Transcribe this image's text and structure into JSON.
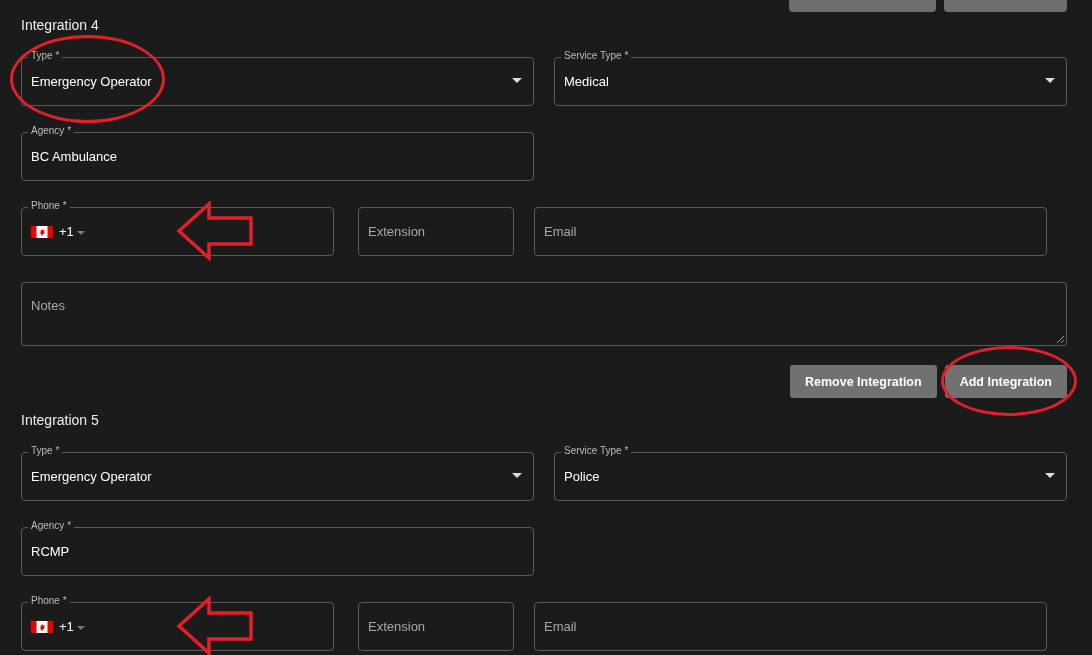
{
  "integrations": [
    {
      "heading": "Integration 4",
      "type": {
        "label": "Type *",
        "value": "Emergency Operator",
        "circled": true
      },
      "service_type": {
        "label": "Service Type *",
        "value": "Medical"
      },
      "agency": {
        "label": "Agency *",
        "value": "BC Ambulance"
      },
      "phone": {
        "label": "Phone *",
        "country_code": "+1",
        "arrow": true
      },
      "extension": {
        "placeholder": "Extension"
      },
      "email": {
        "placeholder": "Email"
      },
      "notes": {
        "placeholder": "Notes"
      },
      "buttons": [
        {
          "label": "Remove Integration",
          "circled": false
        },
        {
          "label": "Add Integration",
          "circled": true
        }
      ]
    },
    {
      "heading": "Integration 5",
      "type": {
        "label": "Type *",
        "value": "Emergency Operator",
        "circled": false
      },
      "service_type": {
        "label": "Service Type *",
        "value": "Police"
      },
      "agency": {
        "label": "Agency *",
        "value": "RCMP"
      },
      "phone": {
        "label": "Phone *",
        "country_code": "+1",
        "arrow": true
      },
      "extension": {
        "placeholder": "Extension"
      },
      "email": {
        "placeholder": "Email"
      }
    }
  ]
}
